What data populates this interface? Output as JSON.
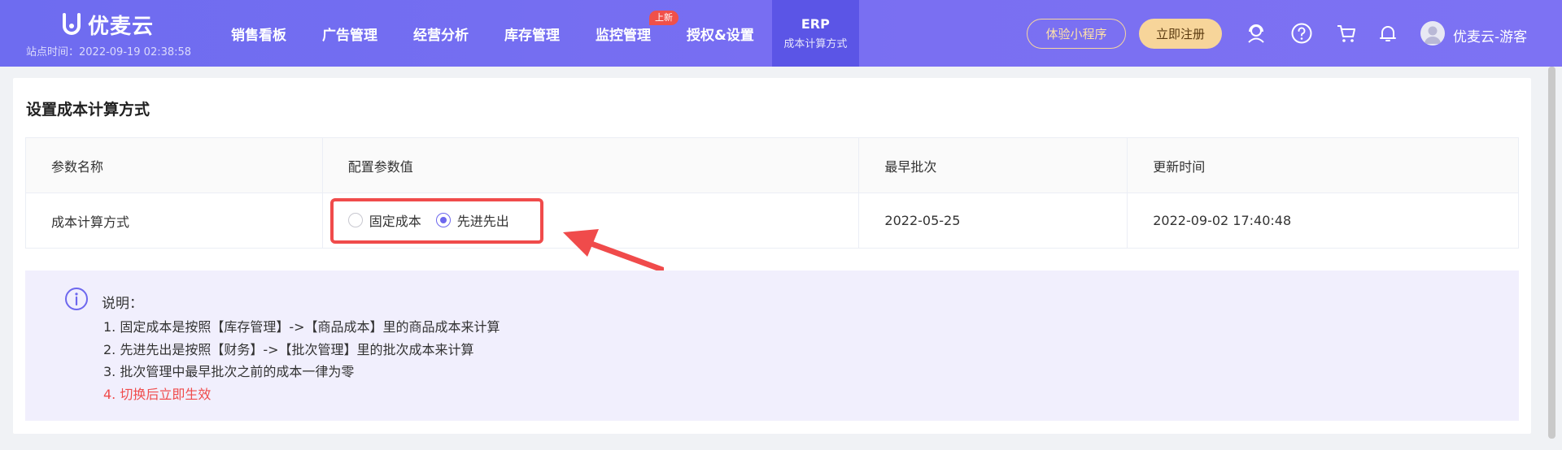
{
  "header": {
    "brand_name": "优麦云",
    "site_time": "站点时间：2022-09-19 02:38:58",
    "nav": [
      {
        "label": "销售看板"
      },
      {
        "label": "广告管理"
      },
      {
        "label": "经营分析"
      },
      {
        "label": "库存管理"
      },
      {
        "label": "监控管理",
        "badge": "上新"
      },
      {
        "label": "授权&设置"
      }
    ],
    "active_nav": {
      "title": "ERP",
      "subtitle": "成本计算方式"
    },
    "mini_program_label": "体验小程序",
    "register_label": "立即注册",
    "user_name": "优麦云-游客",
    "icons": [
      "customer-service-icon",
      "help-icon",
      "cart-icon",
      "bell-icon",
      "avatar-icon"
    ]
  },
  "card": {
    "title": "设置成本计算方式",
    "table": {
      "headers": [
        "参数名称",
        "配置参数值",
        "最早批次",
        "更新时间"
      ],
      "row": {
        "param_name": "成本计算方式",
        "options": [
          {
            "label": "固定成本",
            "checked": false
          },
          {
            "label": "先进先出",
            "checked": true
          }
        ],
        "earliest_batch": "2022-05-25",
        "updated_at": "2022-09-02 17:40:48"
      }
    },
    "notice": {
      "title": "说明：",
      "lines": [
        "1. 固定成本是按照【库存管理】->【商品成本】里的商品成本来计算",
        "2. 先进先出是按照【财务】->【批次管理】里的批次成本来计算",
        "3. 批次管理中最早批次之前的成本一律为零",
        "4. 切换后立即生效"
      ]
    }
  },
  "colors": {
    "header_bg": "#7470f1",
    "accent": "#6d67ee",
    "highlight_red": "#f04b4b",
    "notice_bg": "#f1effd"
  }
}
